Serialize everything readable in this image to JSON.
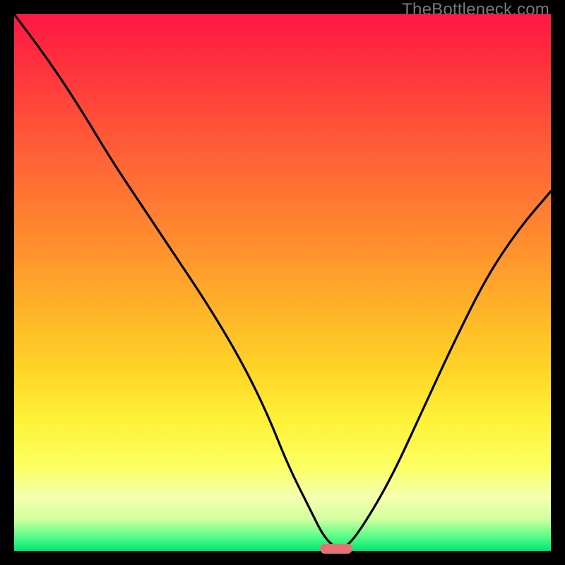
{
  "watermark": "TheBottleneck.com",
  "colors": {
    "frame": "#000000",
    "curve_stroke": "#000000",
    "marker_fill": "#e57373"
  },
  "chart_data": {
    "type": "line",
    "title": "",
    "xlabel": "",
    "ylabel": "",
    "xlim": [
      0,
      100
    ],
    "ylim": [
      0,
      100
    ],
    "grid": false,
    "legend": false,
    "background_gradient": [
      "#ff1744",
      "#ff8c2e",
      "#fff23a",
      "#00e676"
    ],
    "series": [
      {
        "name": "bottleneck-curve",
        "x": [
          0,
          6,
          12,
          18,
          24,
          30,
          36,
          42,
          47,
          51,
          55,
          58,
          61,
          64,
          70,
          76,
          82,
          88,
          94,
          100
        ],
        "y": [
          100,
          92,
          83,
          73,
          64,
          55,
          46,
          36,
          26,
          16,
          8,
          2,
          0,
          3,
          13,
          26,
          39,
          51,
          60,
          67
        ]
      }
    ],
    "marker": {
      "x": 60,
      "y": 0,
      "width_pct": 6
    }
  }
}
